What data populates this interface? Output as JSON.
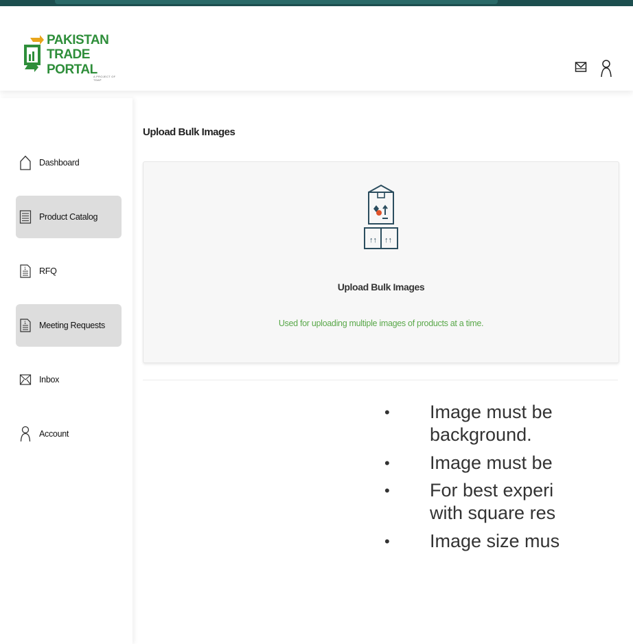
{
  "brand": {
    "line1": "PAKISTAN",
    "line2": "TRADE PORTAL",
    "tagline": "A PROJECT OF TDAP",
    "green": "#2e8e3a"
  },
  "header": {
    "icons": [
      "mail-icon",
      "user-icon"
    ]
  },
  "sidebar": {
    "items": [
      {
        "label": "Dashboard",
        "icon": "home-icon",
        "active": false
      },
      {
        "label": "Product Catalog",
        "icon": "catalog-icon",
        "active": true
      },
      {
        "label": "RFQ",
        "icon": "document-icon",
        "active": false
      },
      {
        "label": "Meeting Requests",
        "icon": "document-icon",
        "active": true
      },
      {
        "label": "Inbox",
        "icon": "inbox-icon",
        "active": false
      },
      {
        "label": "Account",
        "icon": "user-icon",
        "active": false
      }
    ]
  },
  "main": {
    "title": "Upload Bulk Images",
    "card": {
      "title": "Upload Bulk Images",
      "description": "Used for uploading multiple images of products at a time.",
      "icon": "box-upload-icon"
    }
  },
  "notes": [
    {
      "lines": [
        "Image must be",
        "background."
      ]
    },
    {
      "lines": [
        "Image must be"
      ]
    },
    {
      "lines": [
        "For best experi",
        "with square res"
      ]
    },
    {
      "lines": [
        "Image size mus"
      ]
    }
  ],
  "colors": {
    "accent_green": "#5aa84a",
    "active_nav": "#dddddd",
    "top_bar": "#1d4f4f"
  }
}
